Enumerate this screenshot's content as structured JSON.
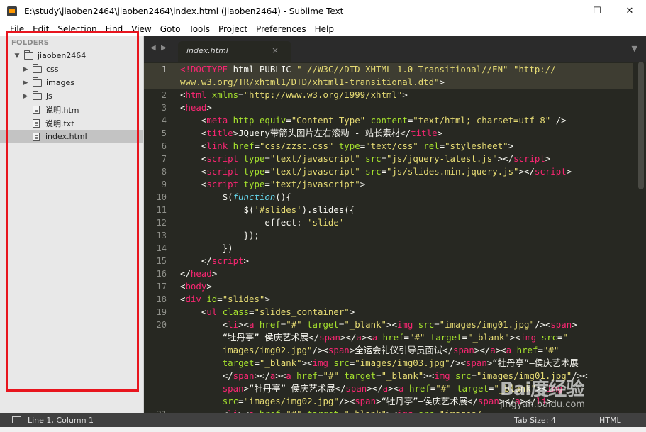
{
  "window": {
    "title": "E:\\study\\jiaoben2464\\jiaoben2464\\index.html (jiaoben2464) - Sublime Text",
    "minimize": "—",
    "maximize": "☐",
    "close": "✕"
  },
  "menu": [
    "File",
    "Edit",
    "Selection",
    "Find",
    "View",
    "Goto",
    "Tools",
    "Project",
    "Preferences",
    "Help"
  ],
  "sidebar": {
    "heading": "FOLDERS",
    "root": "jiaoben2464",
    "folders": [
      "css",
      "images",
      "js"
    ],
    "files": [
      "说明.htm",
      "说明.txt",
      "index.html"
    ],
    "selected": "index.html"
  },
  "tabs": {
    "active": "index.html",
    "close": "×",
    "nav_left": "◀",
    "nav_right": "▶",
    "dropdown": "▼"
  },
  "editor": {
    "line_numbers": [
      "1",
      "",
      "2",
      "3",
      "4",
      "5",
      "6",
      "7",
      "8",
      "9",
      "10",
      "11",
      "12",
      "13",
      "14",
      "15",
      "16",
      "17",
      "18",
      "19",
      "20",
      "",
      "",
      "",
      "",
      "",
      "",
      "21"
    ]
  },
  "status": {
    "position": "Line 1, Column 1",
    "tab_size": "Tab Size: 4",
    "syntax": "HTML"
  },
  "watermark": {
    "logo": "Bai度经验",
    "url": "jingyan.baidu.com"
  },
  "colors": {
    "editor_bg": "#272822",
    "tag": "#f92672",
    "attribute": "#a6e22e",
    "string": "#e6db74",
    "keyword": "#66d9ef",
    "highlight_box": "#e8151e"
  }
}
